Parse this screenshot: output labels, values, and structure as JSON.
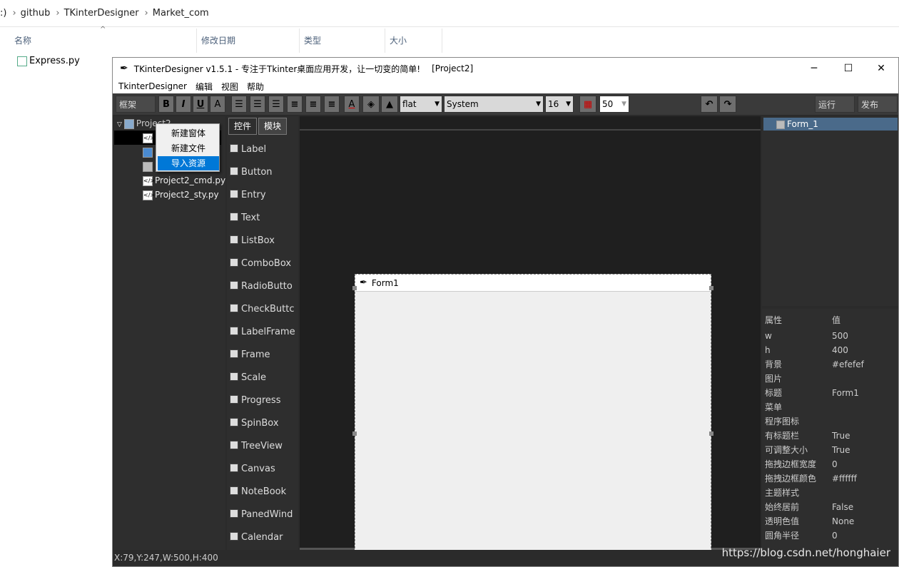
{
  "explorer": {
    "breadcrumb": [
      ":)",
      "github",
      "TKinterDesigner",
      "Market_com"
    ],
    "columns": [
      "名称",
      "修改日期",
      "类型",
      "大小"
    ],
    "file": "Express.py"
  },
  "app": {
    "title": "TKinterDesigner v1.5.1 - 专注于Tkinter桌面应用开发，让一切变的简单!",
    "project_tag": "[Project2]",
    "menu": [
      "TkinterDesigner",
      "编辑",
      "视图",
      "帮助"
    ]
  },
  "toolbar": {
    "frame_label": "框架",
    "bold": "B",
    "italic": "I",
    "underline": "U",
    "font_a": "A",
    "relief": "flat",
    "font": "System",
    "size": "16",
    "zoom": "50",
    "run": "运行",
    "publish": "发布"
  },
  "tree": {
    "root": "Project2",
    "files": [
      "Project2_cmd.py",
      "Project2_sty.py"
    ]
  },
  "context_menu": [
    "新建窗体",
    "新建文件",
    "导入资源"
  ],
  "widget_tabs": [
    "控件",
    "模块"
  ],
  "widgets": [
    "Label",
    "Button",
    "Entry",
    "Text",
    "ListBox",
    "ComboBox",
    "RadioButto",
    "CheckButtc",
    "LabelFrame",
    "Frame",
    "Scale",
    "Progress",
    "SpinBox",
    "TreeView",
    "Canvas",
    "NoteBook",
    "PanedWind",
    "Calendar"
  ],
  "form": {
    "title": "Form1"
  },
  "right_tree": {
    "item": "Form_1"
  },
  "properties": {
    "header_key": "属性",
    "header_val": "值",
    "rows": [
      [
        "w",
        "500"
      ],
      [
        "h",
        "400"
      ],
      [
        "背景",
        "#efefef"
      ],
      [
        "图片",
        ""
      ],
      [
        "标题",
        "Form1"
      ],
      [
        "菜单",
        ""
      ],
      [
        "程序图标",
        ""
      ],
      [
        "有标题栏",
        "True"
      ],
      [
        "可调整大小",
        "True"
      ],
      [
        "拖拽边框宽度",
        "0"
      ],
      [
        "拖拽边框颜色",
        "#ffffff"
      ],
      [
        "主题样式",
        ""
      ],
      [
        "始终居前",
        "False"
      ],
      [
        "透明色值",
        "None"
      ],
      [
        "圆角半径",
        "0"
      ]
    ]
  },
  "status": "X:79,Y:247,W:500,H:400",
  "watermark": "https://blog.csdn.net/honghaier"
}
